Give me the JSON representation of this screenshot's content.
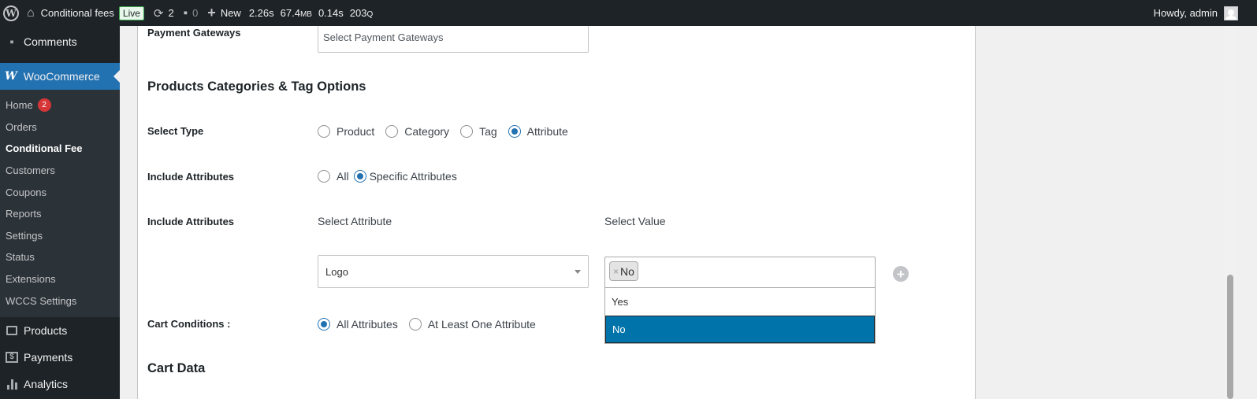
{
  "admin_bar": {
    "site_name": "Conditional fees",
    "live_badge": "Live",
    "updates_count": "2",
    "comments_count": "0",
    "new_label": "New",
    "stats": {
      "time": "2.26s",
      "memory": "67.4",
      "memory_unit": "MB",
      "db_time": "0.14s",
      "queries": "203",
      "queries_unit": "Q"
    },
    "greeting": "Howdy, admin"
  },
  "sidebar": {
    "comments": "Comments",
    "woocommerce": "WooCommerce",
    "submenu": [
      {
        "label": "Home",
        "badge": "2"
      },
      {
        "label": "Orders"
      },
      {
        "label": "Conditional Fee",
        "current": true
      },
      {
        "label": "Customers"
      },
      {
        "label": "Coupons"
      },
      {
        "label": "Reports"
      },
      {
        "label": "Settings"
      },
      {
        "label": "Status"
      },
      {
        "label": "Extensions"
      },
      {
        "label": "WCCS Settings"
      }
    ],
    "products": "Products",
    "payments": "Payments",
    "analytics": "Analytics"
  },
  "form": {
    "payment_gateways_label": "Payment Gateways",
    "payment_gateways_placeholder": "Select Payment Gateways",
    "section_products_title": "Products Categories & Tag Options",
    "select_type_label": "Select Type",
    "select_type_options": [
      "Product",
      "Category",
      "Tag",
      "Attribute"
    ],
    "select_type_selected": "Attribute",
    "include_attributes_label": "Include Attributes",
    "include_attributes_options": [
      "All",
      "Specific Attributes"
    ],
    "include_attributes_selected": "Specific Attributes",
    "include_attributes_label_2": "Include Attributes",
    "select_attribute_heading": "Select Attribute",
    "select_value_heading": "Select Value",
    "attribute_value": "Logo",
    "selected_tag": "No",
    "tag_remove": "×",
    "dropdown_options": [
      "Yes",
      "No"
    ],
    "dropdown_highlighted": "No",
    "cart_conditions_label": "Cart Conditions :",
    "cart_conditions_options": [
      "All Attributes",
      "At Least One Attribute"
    ],
    "cart_conditions_selected": "All Attributes",
    "cart_data_title": "Cart Data"
  },
  "icons": {
    "wp_logo": "W",
    "home": "⌂",
    "refresh": "⟳",
    "comment": "▪",
    "plus": "+",
    "add_row": "+",
    "woo": "W"
  },
  "colors": {
    "admin_bar_bg": "#1d2327",
    "sidebar_active": "#2271b1",
    "highlight_option": "#0073aa",
    "radio_checked": "#2271b1",
    "badge": "#d63638"
  }
}
